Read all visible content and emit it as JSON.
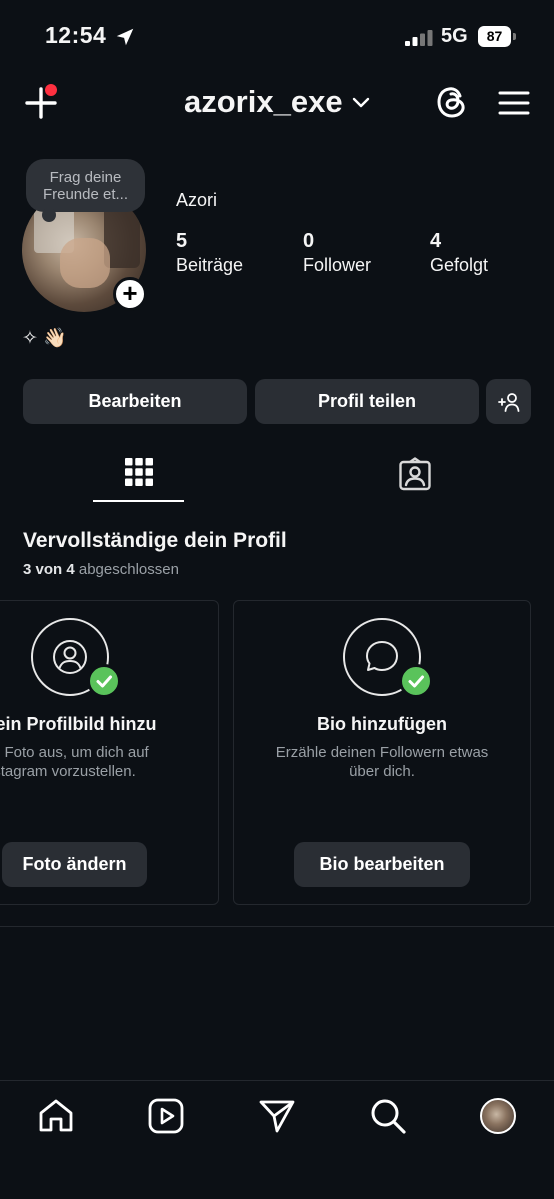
{
  "status_bar": {
    "time": "12:54",
    "network": "5G",
    "battery": "87"
  },
  "header": {
    "username": "azorix_exe"
  },
  "profile": {
    "note": "Frag deine Freunde et...",
    "display_name": "Azori",
    "stats": [
      {
        "value": "5",
        "label": "Beiträge"
      },
      {
        "value": "0",
        "label": "Follower"
      },
      {
        "value": "4",
        "label": "Gefolgt"
      }
    ],
    "bio": "✧ 👋🏻"
  },
  "actions": {
    "edit_label": "Bearbeiten",
    "share_label": "Profil teilen"
  },
  "complete_profile": {
    "title": "Vervollständige dein Profil",
    "progress_done": "3 von 4",
    "progress_suffix": "abgeschlossen",
    "cards": [
      {
        "title": "e ein Profilbild hinzu",
        "desc_line1": "ein Foto aus, um dich auf",
        "desc_line2": "stagram vorzustellen.",
        "button": "Foto ändern"
      },
      {
        "title": "Bio hinzufügen",
        "desc_line1": "Erzähle deinen Followern etwas",
        "desc_line2": "über dich.",
        "button": "Bio bearbeiten"
      }
    ]
  },
  "colors": {
    "background": "#0c1015",
    "button": "#2a2e34",
    "check": "#5ac35b",
    "notification_dot": "#ff3040"
  }
}
